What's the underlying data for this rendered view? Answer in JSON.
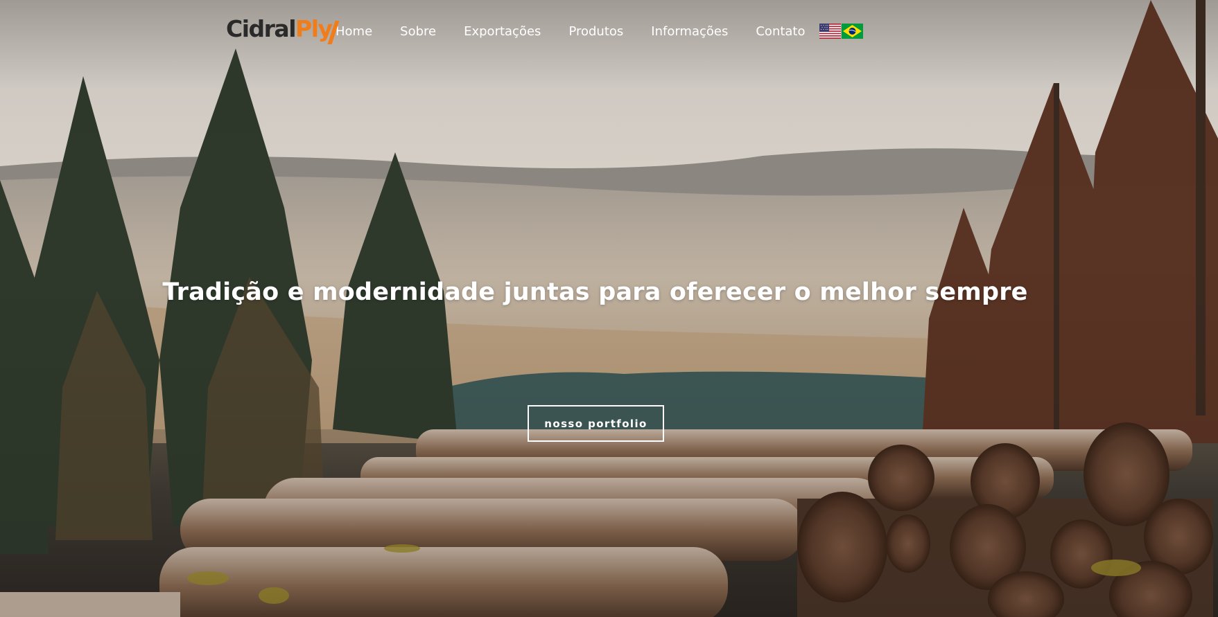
{
  "brand": {
    "logo_part1": "Cidral",
    "logo_part2": "Ply",
    "accent_color": "#f07d1a",
    "dark_color": "#2a2a2a"
  },
  "nav": {
    "items": [
      {
        "label": "Home"
      },
      {
        "label": "Sobre"
      },
      {
        "label": "Exportações"
      },
      {
        "label": "Produtos"
      },
      {
        "label": "Informações"
      },
      {
        "label": "Contato"
      }
    ],
    "languages": [
      {
        "icon": "us-flag-icon"
      },
      {
        "icon": "brazil-flag-icon"
      }
    ]
  },
  "hero": {
    "headline": "Tradição e modernidade juntas para oferecer o melhor sempre",
    "cta_label": "nosso portfolio"
  }
}
